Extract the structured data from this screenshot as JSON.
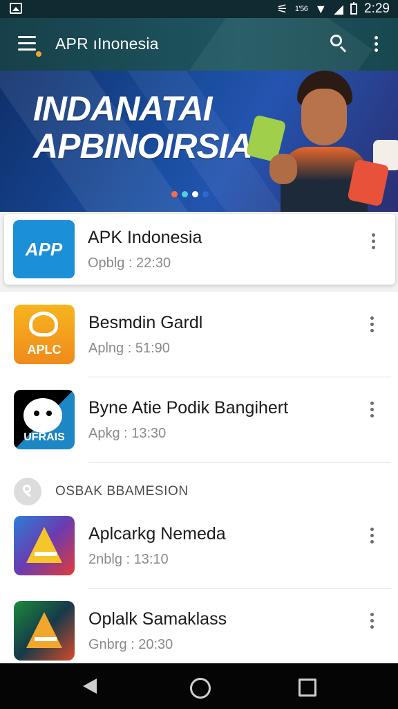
{
  "status_bar": {
    "time": "2:29",
    "small_text": "1'56"
  },
  "app_bar": {
    "title": "APR ıInonesia",
    "icons": [
      "menu-icon",
      "search-icon",
      "more-vert-icon"
    ]
  },
  "banner": {
    "line1": "INDANATAI",
    "line2": "APBINOIRSIA",
    "dot_colors": [
      "#ff6b4a",
      "#4ed0e0",
      "#ffffff",
      "#2d6ad0"
    ]
  },
  "featured": {
    "name": "APK Indonesia",
    "subtitle": "Opblg : 22:30",
    "icon_text": "APP"
  },
  "list": [
    {
      "name": "Besmdin Gardl",
      "subtitle": "Aplng : 51:90",
      "icon_text": "APLC"
    },
    {
      "name": "Byne Atie Podik Bangihert",
      "subtitle": "Apkg : 13:30",
      "icon_text": "UFRAIS"
    }
  ],
  "section": {
    "title": "OSBAK BBAMESION"
  },
  "section_list": [
    {
      "name": "Aplcarkg Nemeda",
      "subtitle": "2nblg : 13:10"
    },
    {
      "name": "Oplalk Samaklass",
      "subtitle": "Gnbrg : 20:30"
    }
  ],
  "nav_bar": {
    "icons": [
      "back-icon",
      "home-icon",
      "recents-icon"
    ]
  }
}
